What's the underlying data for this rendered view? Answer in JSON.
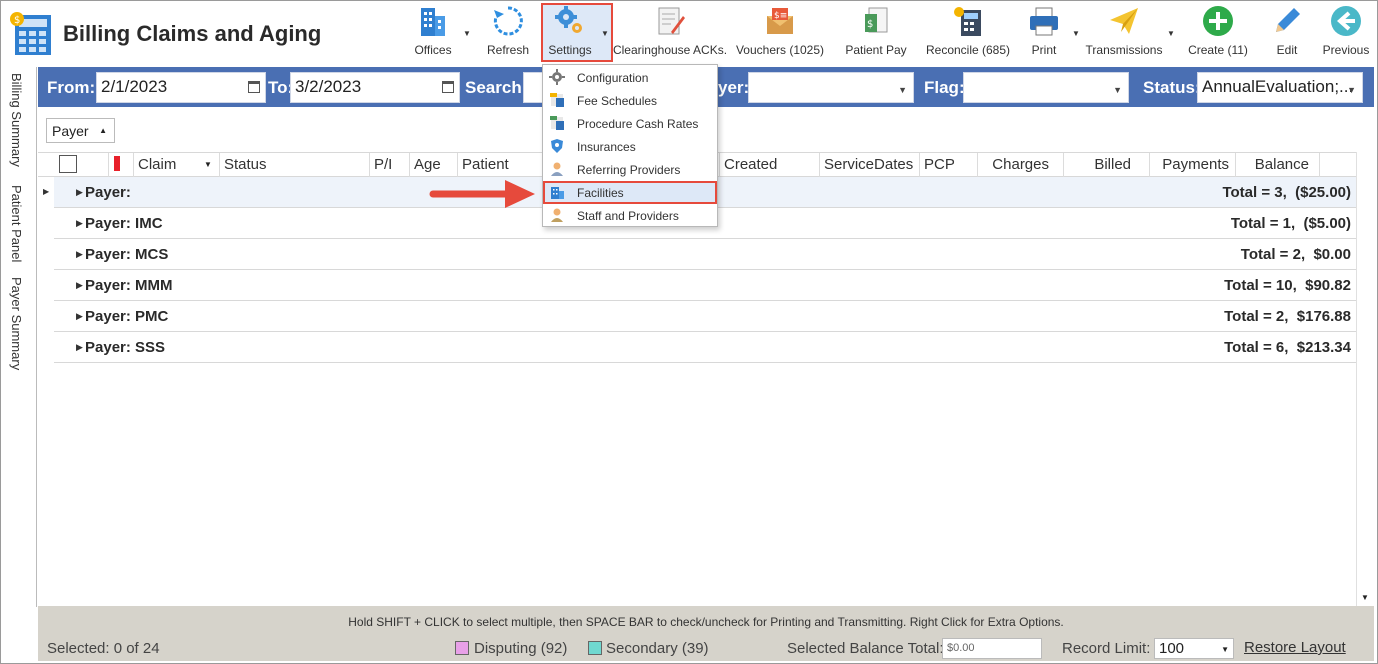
{
  "app": {
    "title": "Billing Claims and Aging"
  },
  "toolbar": {
    "offices": "Offices",
    "refresh": "Refresh",
    "settings": "Settings",
    "clearinghouse": "Clearinghouse ACKs.",
    "vouchers": "Vouchers (1025)",
    "patient_pay": "Patient Pay",
    "reconcile": "Reconcile (685)",
    "print": "Print",
    "transmissions": "Transmissions",
    "create": "Create (11)",
    "edit": "Edit",
    "previous": "Previous"
  },
  "filters": {
    "from_label": "From:",
    "from_value": "2/1/2023",
    "to_label": "To:",
    "to_value": "3/2/2023",
    "search_label": "Search:",
    "payer_label": "yer:",
    "flag_label": "Flag:",
    "status_label": "Status:",
    "status_value": "AnnualEvaluation;..."
  },
  "side_tabs": [
    "Billing Summary",
    "Patient Panel",
    "Payer Summary"
  ],
  "group_by": "Payer",
  "columns": {
    "claim": "Claim",
    "status": "Status",
    "pi": "P/I",
    "age": "Age",
    "patient": "Patient",
    "created": "Created",
    "service_dates": "ServiceDates",
    "pcp": "PCP",
    "charges": "Charges",
    "billed": "Billed",
    "payments": "Payments",
    "balance": "Balance"
  },
  "groups": [
    {
      "label": "Payer:",
      "total": "Total = 3,  ($25.00)"
    },
    {
      "label": "Payer: IMC",
      "total": "Total = 1,  ($5.00)"
    },
    {
      "label": "Payer: MCS",
      "total": "Total = 2,  $0.00"
    },
    {
      "label": "Payer: MMM",
      "total": "Total = 10,  $90.82"
    },
    {
      "label": "Payer: PMC",
      "total": "Total = 2,  $176.88"
    },
    {
      "label": "Payer: SSS",
      "total": "Total = 6,  $213.34"
    }
  ],
  "settings_menu": [
    {
      "label": "Configuration",
      "icon": "gear-icon"
    },
    {
      "label": "Fee Schedules",
      "icon": "fee-schedule-icon"
    },
    {
      "label": "Procedure Cash Rates",
      "icon": "cash-rates-icon"
    },
    {
      "label": "Insurances",
      "icon": "shield-icon"
    },
    {
      "label": "Referring Providers",
      "icon": "provider-icon"
    },
    {
      "label": "Facilities",
      "icon": "building-icon"
    },
    {
      "label": "Staff and Providers",
      "icon": "staff-icon"
    }
  ],
  "footer": {
    "hint": "Hold SHIFT + CLICK to select multiple, then SPACE BAR to check/uncheck for Printing and Transmitting. Right Click for Extra Options.",
    "selected": "Selected: 0 of 24",
    "disputing": "Disputing (92)",
    "secondary": "Secondary (39)",
    "selected_balance_label": "Selected Balance Total:",
    "selected_balance_value": "$0.00",
    "record_limit_label": "Record Limit:",
    "record_limit_value": "100",
    "restore_layout": "Restore Layout"
  },
  "colors": {
    "filter_bar": "#4a6fb3",
    "highlight_border": "#e64a3c",
    "disputing": "#e8a0e8",
    "secondary": "#70d8d0"
  }
}
